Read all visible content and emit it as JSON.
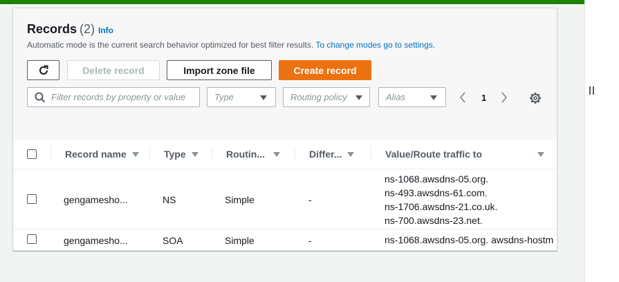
{
  "header": {
    "title": "Records",
    "count": "(2)",
    "info_link": "Info",
    "description": "Automatic mode is the current search behavior optimized for best filter results.",
    "description_link": "To change modes go to settings."
  },
  "actions": {
    "delete_label": "Delete record",
    "import_label": "Import zone file",
    "create_label": "Create record"
  },
  "filters": {
    "search_placeholder": "Filter records by property or value",
    "type_placeholder": "Type",
    "routing_placeholder": "Routing policy",
    "alias_placeholder": "Alias"
  },
  "pagination": {
    "current_page": "1"
  },
  "table": {
    "columns": [
      "Record name",
      "Type",
      "Routin...",
      "Differ...",
      "Value/Route traffic to"
    ],
    "rows": [
      {
        "name": "gengamesho...",
        "type": "NS",
        "routing": "Simple",
        "differentiator": "-",
        "values": [
          "ns-1068.awsdns-05.org.",
          "ns-493.awsdns-61.com.",
          "ns-1706.awsdns-21.co.uk.",
          "ns-700.awsdns-23.net."
        ]
      },
      {
        "name": "gengamesho...",
        "type": "SOA",
        "routing": "Simple",
        "differentiator": "-",
        "values": [
          "ns-1068.awsdns-05.org. awsdns-hostm"
        ]
      }
    ]
  },
  "colors": {
    "accent": "#ec7211",
    "link": "#0073bb",
    "success_strip": "#1d8102"
  }
}
